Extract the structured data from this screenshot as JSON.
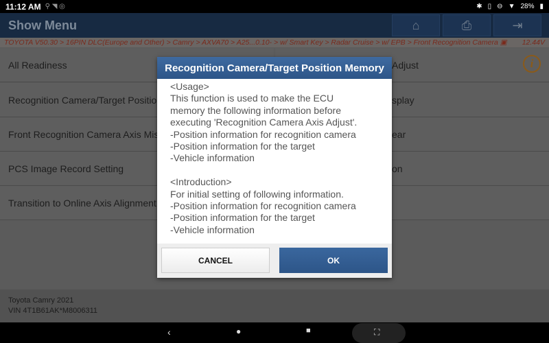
{
  "status_bar": {
    "time": "11:12 AM",
    "battery": "28%"
  },
  "header": {
    "title": "Show Menu",
    "buttons": [
      "home-icon",
      "print-icon",
      "exit-icon"
    ]
  },
  "breadcrumb": {
    "path": "TOYOTA V50.30 > 16PIN DLC(Europe and Other) > Camry > AXVA70 > A25...0.10- > w/ Smart Key > Radar Cruise > w/ EPB > Front Recognition Camera",
    "voltage": "12.44V"
  },
  "menu": {
    "left": [
      "All Readiness",
      "Recognition Camera/Target Position Memory",
      "Front Recognition Camera Axis Misalignment",
      "PCS Image Record Setting",
      "Transition to Online Axis Alignment"
    ],
    "right_visible": [
      "Adjust",
      "splay",
      "ear",
      "on",
      ""
    ]
  },
  "vehicle": {
    "model": "Toyota Camry 2021",
    "vin": "VIN 4T1B61AK*M8006311"
  },
  "dialog": {
    "title": "Recognition Camera/Target Position Memory",
    "body": "<Usage>\nThis function is used to make the ECU\nmemory the following information before\nexecuting 'Recognition Camera Axis Adjust'.\n-Position information for recognition camera\n-Position information for the target\n-Vehicle information\n\n<Introduction>\nFor initial setting of following information.\n-Position information for recognition camera\n-Position information for the target\n-Vehicle information",
    "cancel_label": "CANCEL",
    "ok_label": "OK"
  },
  "colors": {
    "accent": "#2d5588",
    "breadcrumb_text": "#c0392b",
    "info": "#e08a1e"
  }
}
